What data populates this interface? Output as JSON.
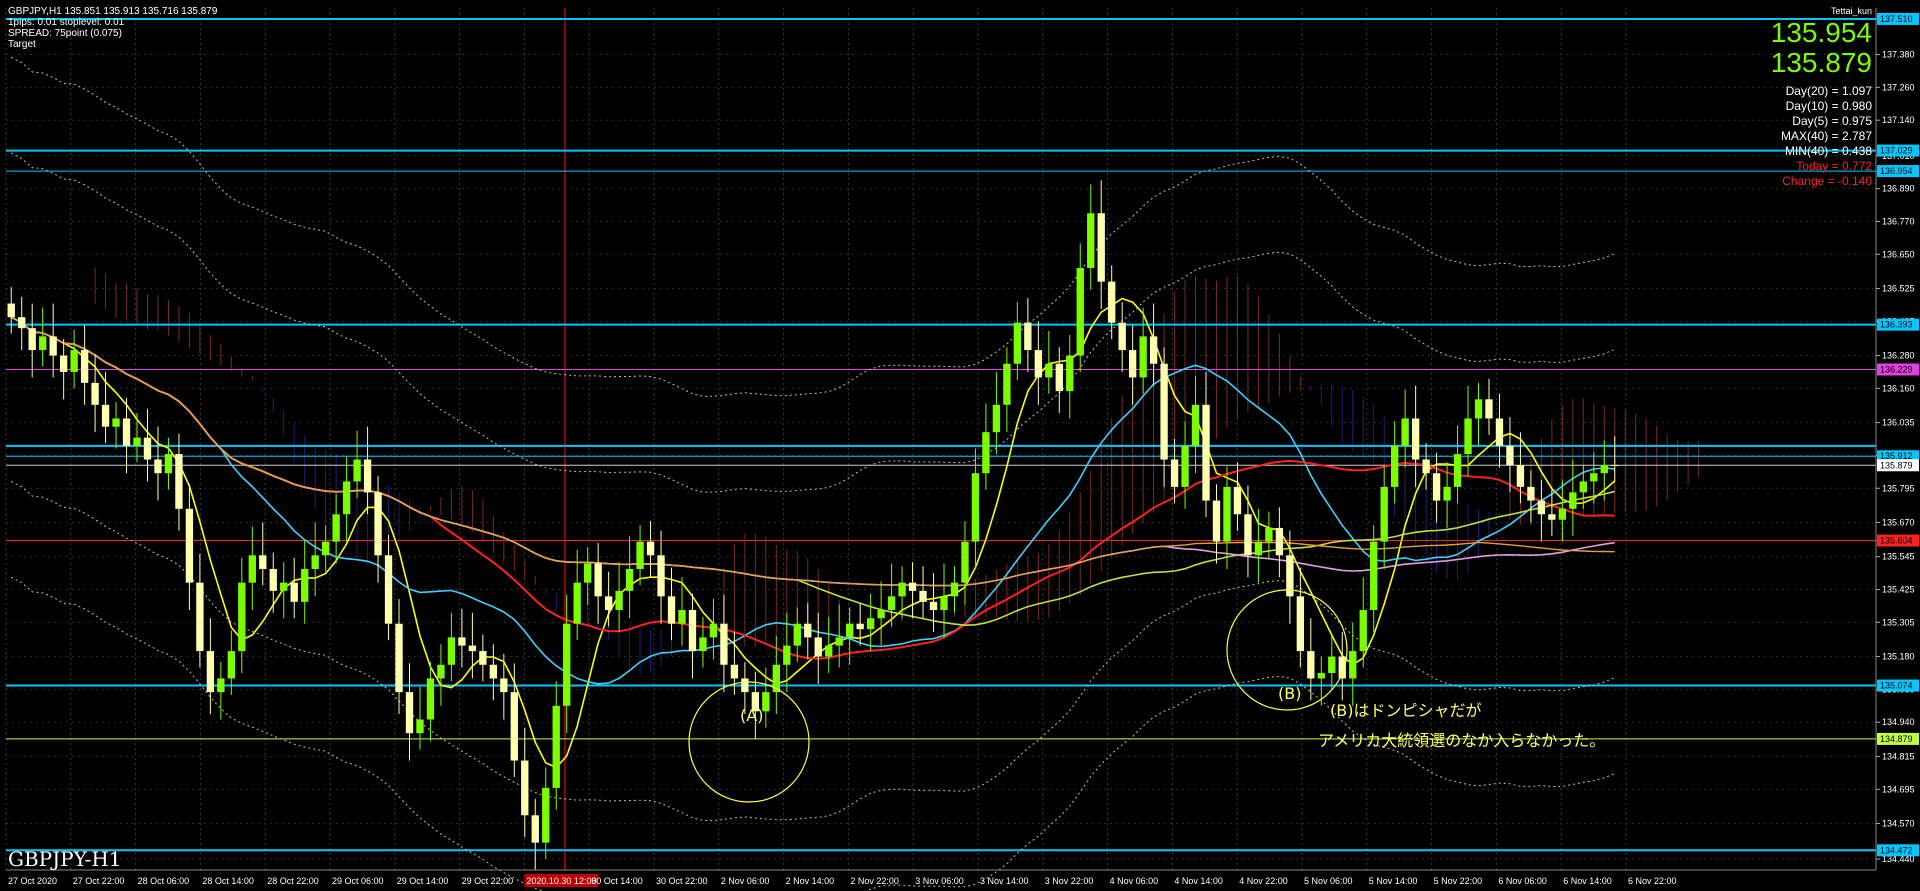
{
  "header": {
    "line1": "GBPJPY,H1  135.851 135.913 135.716 135.879",
    "line2": "1pips: 0.01  stoplevel: 0.01",
    "line3": "SPREAD: 75point (0.075)",
    "line4": "Target"
  },
  "owner": "Tettai_kun",
  "panel": {
    "bid": "135.954",
    "ask": "135.879",
    "rows": [
      "Day(20) = 1.097",
      "Day(10) = 0.980",
      "Day(5) = 0.975",
      "MAX(40) = 2.787",
      "MIN(40) = 0.438",
      "Today = 0.772",
      "Change = -0.140"
    ]
  },
  "symbol_label": "GBPJPY-H1",
  "annotations": {
    "a_label": "(A)",
    "b_label": "(B)",
    "note1": "(B)はドンピシャだが",
    "note2": "アメリカ大統領選のなか入らなかった。"
  },
  "colors": {
    "bull": "#7CFC00",
    "bear": "#ffffb0",
    "cyan_line": "#00c8ff",
    "ma_red": "#ff2020",
    "ma_yellow": "#ffff00",
    "ma_cyan": "#40d0ff",
    "ma_green": "#c0e040",
    "ma_pink": "#e0a0e0",
    "ma_orange": "#e0a040",
    "ma_white": "#ffe0c0"
  },
  "chart_data": {
    "type": "candlestick",
    "symbol": "GBPJPY",
    "timeframe": "H1",
    "ylim": [
      134.4,
      137.55
    ],
    "y_ticks": [
      "137.510",
      "137.380",
      "137.260",
      "137.140",
      "137.010",
      "136.890",
      "136.770",
      "136.650",
      "136.525",
      "136.405",
      "136.280",
      "136.160",
      "136.035",
      "135.915",
      "135.795",
      "135.670",
      "135.545",
      "135.425",
      "135.305",
      "135.180",
      "135.060",
      "134.940",
      "134.815",
      "134.695",
      "134.570",
      "134.440"
    ],
    "x_labels": [
      "27 Oct 2020",
      "27 Oct 22:00",
      "28 Oct 06:00",
      "28 Oct 14:00",
      "28 Oct 22:00",
      "29 Oct 06:00",
      "29 Oct 14:00",
      "29 Oct 22:00",
      "2020.10.30 12:00",
      "30 Oct 14:00",
      "30 Oct 22:00",
      "2 Nov 06:00",
      "2 Nov 14:00",
      "2 Nov 22:00",
      "3 Nov 06:00",
      "3 Nov 14:00",
      "3 Nov 22:00",
      "4 Nov 06:00",
      "4 Nov 14:00",
      "4 Nov 22:00",
      "5 Nov 06:00",
      "5 Nov 14:00",
      "5 Nov 22:00",
      "6 Nov 06:00",
      "6 Nov 14:00",
      "6 Nov 22:00"
    ],
    "price_tags": [
      {
        "label": "137.510",
        "value": 137.51,
        "color": "#00c8ff"
      },
      {
        "label": "137.029",
        "value": 137.029,
        "color": "#00c8ff"
      },
      {
        "label": "136.954",
        "value": 136.954,
        "color": "#00c8ff"
      },
      {
        "label": "136.393",
        "value": 136.393,
        "color": "#00c8ff"
      },
      {
        "label": "136.229",
        "value": 136.229,
        "color": "#e040e0"
      },
      {
        "label": "135.912",
        "value": 135.912,
        "color": "#00c8ff"
      },
      {
        "label": "135.879",
        "value": 135.879,
        "color": "#ffffff"
      },
      {
        "label": "135.604",
        "value": 135.604,
        "color": "#ff2020"
      },
      {
        "label": "135.074",
        "value": 135.074,
        "color": "#00c8ff"
      },
      {
        "label": "134.879",
        "value": 134.879,
        "color": "#c0ff40"
      },
      {
        "label": "134.472",
        "value": 134.472,
        "color": "#00c8ff"
      }
    ],
    "hlines": [
      {
        "value": 137.51,
        "color": "#00c8ff",
        "width": 2
      },
      {
        "value": 137.029,
        "color": "#00c8ff",
        "width": 2
      },
      {
        "value": 136.954,
        "color": "#00c8ff",
        "width": 1
      },
      {
        "value": 136.393,
        "color": "#00c8ff",
        "width": 2
      },
      {
        "value": 136.229,
        "color": "#e040e0",
        "width": 1
      },
      {
        "value": 135.95,
        "color": "#00c8ff",
        "width": 2
      },
      {
        "value": 135.912,
        "color": "#00c8ff",
        "width": 1
      },
      {
        "value": 135.879,
        "color": "#d0d0d0",
        "width": 1
      },
      {
        "value": 135.604,
        "color": "#ff2020",
        "width": 1
      },
      {
        "value": 135.074,
        "color": "#00c8ff",
        "width": 2
      },
      {
        "value": 134.879,
        "color": "#c0ff40",
        "width": 1
      },
      {
        "value": 134.472,
        "color": "#00c8ff",
        "width": 2
      }
    ],
    "close": [
      136.42,
      136.38,
      136.3,
      136.35,
      136.28,
      136.22,
      136.3,
      136.18,
      136.1,
      136.02,
      136.05,
      135.95,
      135.98,
      135.9,
      135.85,
      135.92,
      135.72,
      135.45,
      135.2,
      135.05,
      135.1,
      135.2,
      135.45,
      135.55,
      135.5,
      135.42,
      135.45,
      135.38,
      135.5,
      135.55,
      135.6,
      135.7,
      135.82,
      135.9,
      135.78,
      135.55,
      135.3,
      135.05,
      134.9,
      134.95,
      135.1,
      135.15,
      135.25,
      135.22,
      135.2,
      135.15,
      135.1,
      135.05,
      134.8,
      134.6,
      134.5,
      134.7,
      135.0,
      135.3,
      135.45,
      135.52,
      135.4,
      135.35,
      135.42,
      135.5,
      135.6,
      135.55,
      135.4,
      135.3,
      135.35,
      135.2,
      135.25,
      135.3,
      135.15,
      135.1,
      135.05,
      134.98,
      135.05,
      135.15,
      135.22,
      135.3,
      135.25,
      135.18,
      135.22,
      135.25,
      135.3,
      135.28,
      135.32,
      135.35,
      135.4,
      135.45,
      135.42,
      135.38,
      135.35,
      135.4,
      135.45,
      135.6,
      135.85,
      136.0,
      136.1,
      136.25,
      136.4,
      136.3,
      136.2,
      136.25,
      136.15,
      136.28,
      136.6,
      136.8,
      136.55,
      136.4,
      136.3,
      136.2,
      136.35,
      136.25,
      135.9,
      135.8,
      135.95,
      136.1,
      135.75,
      135.6,
      135.8,
      135.7,
      135.55,
      135.6,
      135.65,
      135.55,
      135.4,
      135.2,
      135.1,
      135.12,
      135.18,
      135.1,
      135.2,
      135.35,
      135.6,
      135.8,
      135.95,
      136.05,
      135.9,
      135.85,
      135.75,
      135.8,
      135.92,
      136.05,
      136.12,
      136.05,
      135.95,
      135.88,
      135.8,
      135.75,
      135.7,
      135.68,
      135.72,
      135.78,
      135.82,
      135.85,
      135.88,
      135.879
    ]
  }
}
